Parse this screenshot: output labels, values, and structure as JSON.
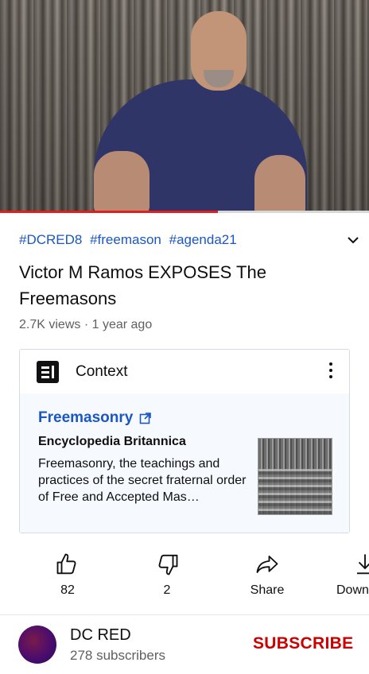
{
  "video": {
    "progress_fraction": 0.59
  },
  "hashtags": [
    "#DCRED8",
    "#freemason",
    "#agenda21"
  ],
  "title": "Victor M Ramos EXPOSES The Freemasons",
  "meta": {
    "views": "2.7K views",
    "separator": "·",
    "age": "1 year ago"
  },
  "context": {
    "header": "Context",
    "topic": "Freemasonry",
    "source": "Encyclopedia Britannica",
    "description": "Freemasonry, the teachings and practices of the secret fraternal order of Free and Accepted Mas…"
  },
  "actions": {
    "like_count": "82",
    "dislike_count": "2",
    "share_label": "Share",
    "download_label": "Down"
  },
  "channel": {
    "name": "DC RED",
    "subscribers": "278 subscribers",
    "subscribe_label": "SUBSCRIBE"
  },
  "colors": {
    "accent_link": "#1a57c4",
    "subscribe": "#cc0000",
    "progress": "#e02020"
  },
  "icons": [
    "chevron-down-icon",
    "article-icon",
    "more-vert-icon",
    "external-link-icon",
    "thumbs-up-icon",
    "thumbs-down-icon",
    "share-icon",
    "download-icon"
  ]
}
